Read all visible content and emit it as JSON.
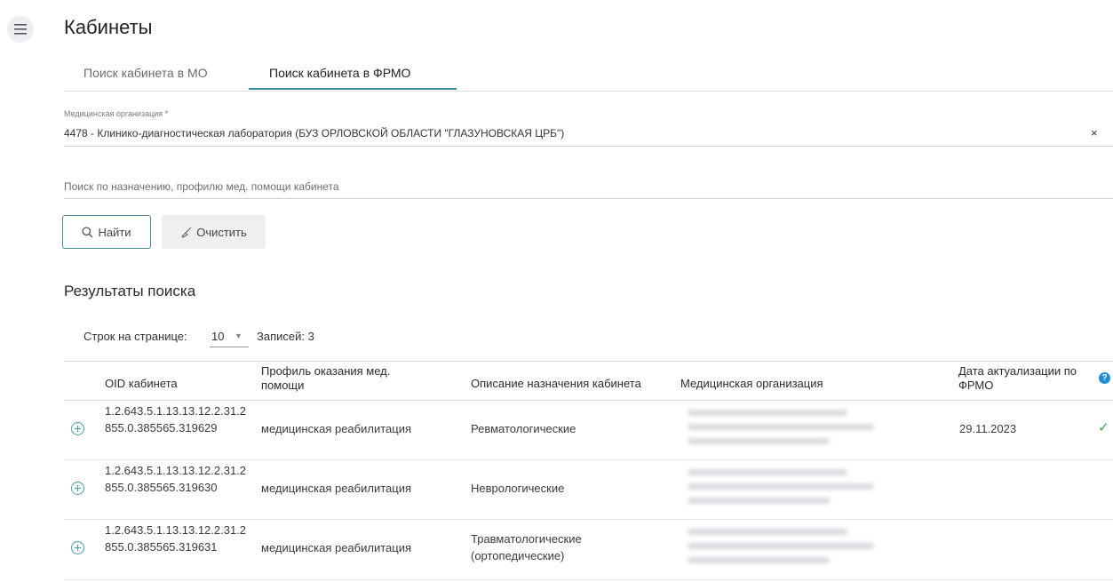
{
  "header": {
    "title": "Кабинеты",
    "menu_icon": "hamburger-menu-icon"
  },
  "tabs": [
    {
      "label": "Поиск кабинета в МО",
      "active": false
    },
    {
      "label": "Поиск кабинета в ФРМО",
      "active": true
    }
  ],
  "form": {
    "org_label": "Медицинская организация *",
    "org_value": "4478 - Клинико-диагностическая лаборатория (БУЗ ОРЛОВСКОЙ ОБЛАСТИ \"ГЛАЗУНОВСКАЯ ЦРБ\")",
    "org_clear": "×",
    "search_placeholder": "Поиск по назначению, профилю мед. помощи кабинета",
    "find_label": "Найти",
    "clear_label": "Очистить"
  },
  "results": {
    "title": "Результаты поиска",
    "rows_per_page_label": "Строк на странице:",
    "rows_per_page_value": "10",
    "records_label": "Записей:",
    "records_count": "3"
  },
  "table": {
    "columns": [
      "OID кабинета",
      "Профиль оказания мед. помощи",
      "Описание назначения кабинета",
      "Медицинская организация",
      "Дата актуализации по ФРМО"
    ],
    "help_icon": "?",
    "rows": [
      {
        "oid": "1.2.643.5.1.13.13.12.2.31.2855.0.385565.319629",
        "profile": "медицинская реабилитация",
        "description": "Ревматологические",
        "date": "29.11.2023",
        "check": "✓"
      },
      {
        "oid": "1.2.643.5.1.13.13.12.2.31.2855.0.385565.319630",
        "profile": "медицинская реабилитация",
        "description": "Неврологические",
        "date": "",
        "check": ""
      },
      {
        "oid": "1.2.643.5.1.13.13.12.2.31.2855.0.385565.319631",
        "profile": "медицинская реабилитация",
        "description": "Травматологические (ортопедические)",
        "date": "",
        "check": ""
      }
    ]
  },
  "colors": {
    "accent": "#3b8b9a",
    "check": "#3fa64a",
    "help": "#1e8fd6"
  }
}
